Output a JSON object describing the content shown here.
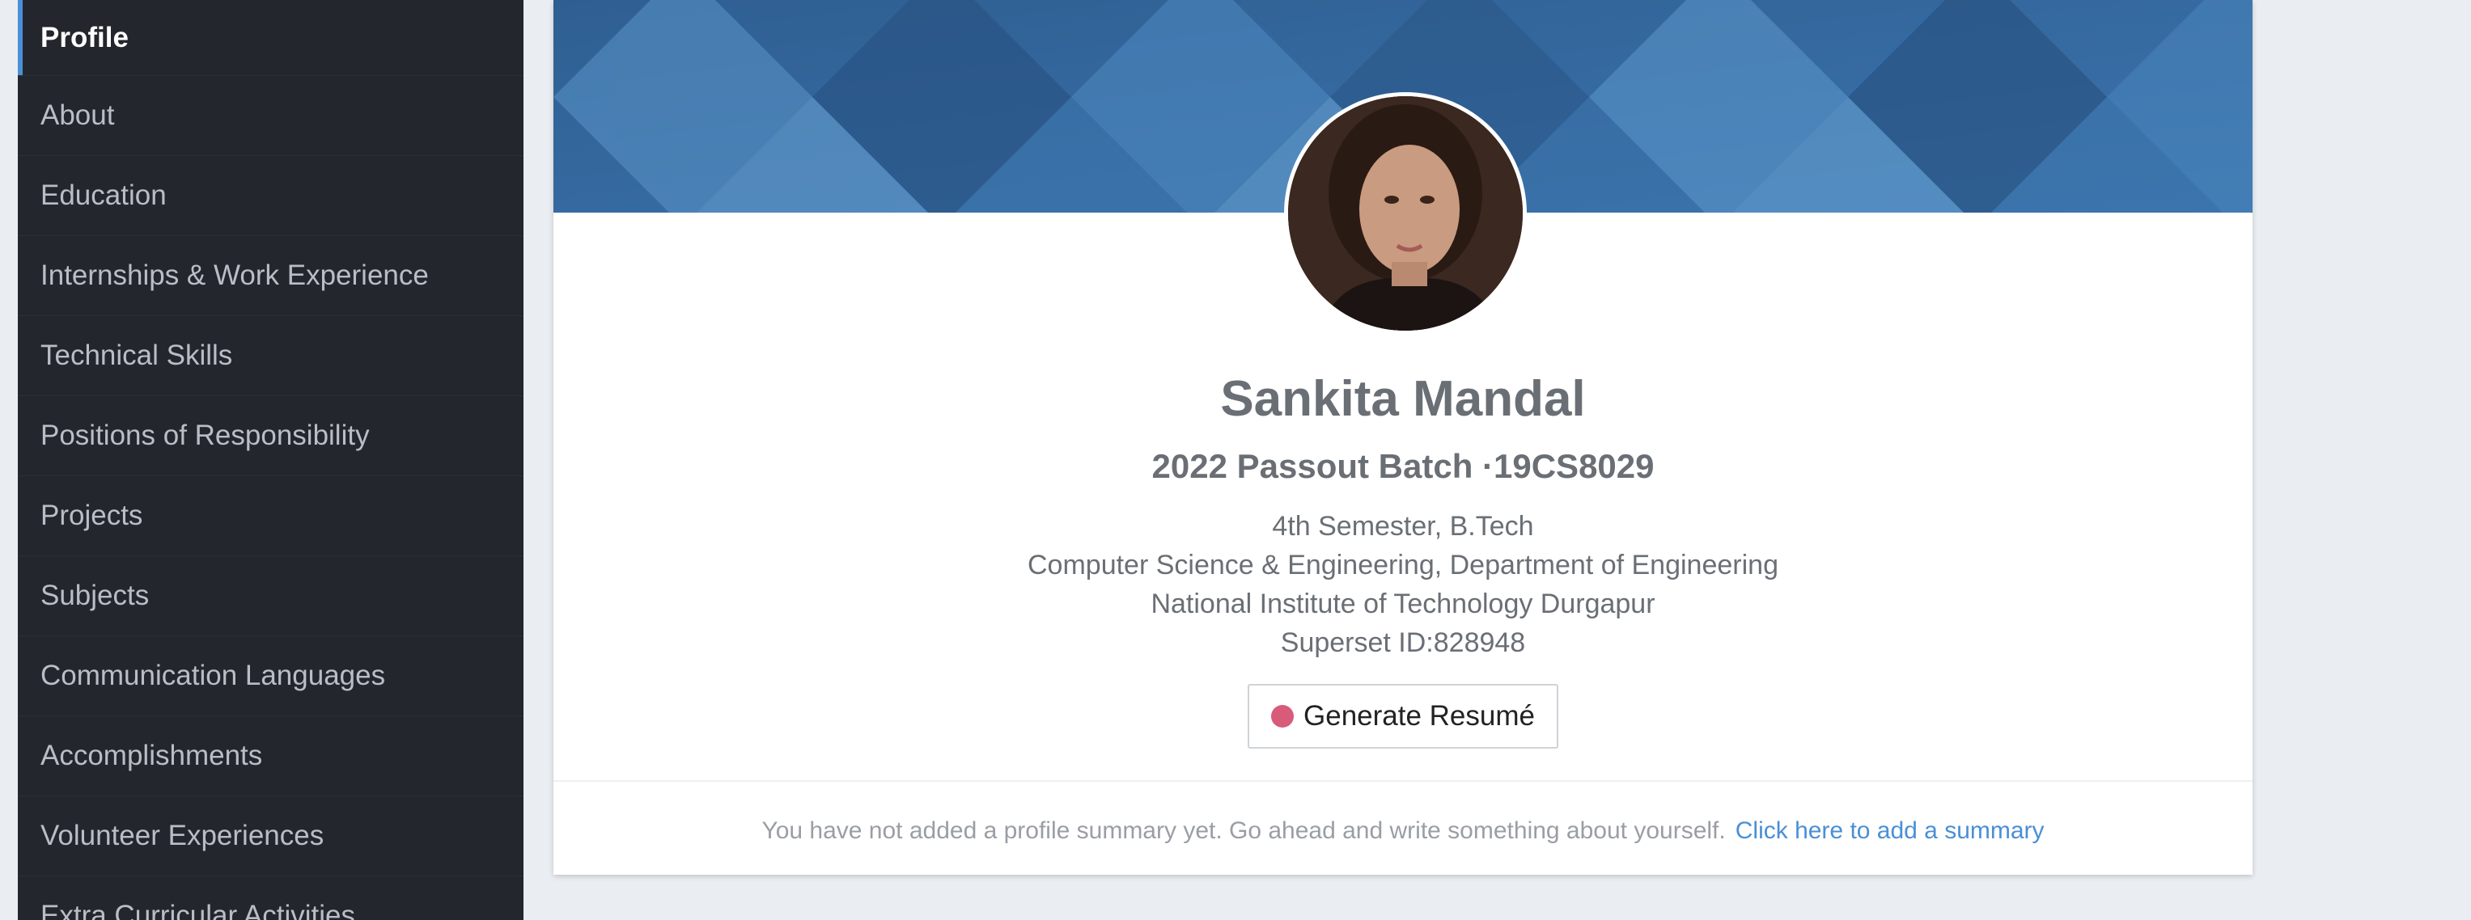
{
  "sidebar": {
    "items": [
      {
        "label": "Profile",
        "active": true
      },
      {
        "label": "About"
      },
      {
        "label": "Education"
      },
      {
        "label": "Internships & Work Experience"
      },
      {
        "label": "Technical Skills"
      },
      {
        "label": "Positions of Responsibility"
      },
      {
        "label": "Projects"
      },
      {
        "label": "Subjects"
      },
      {
        "label": "Communication Languages"
      },
      {
        "label": "Accomplishments"
      },
      {
        "label": "Volunteer Experiences"
      },
      {
        "label": "Extra Curricular Activities"
      }
    ]
  },
  "profile": {
    "name": "Sankita Mandal",
    "batch": "2022 Passout Batch ·19CS8029",
    "semester": "4th Semester, B.Tech",
    "department": "Computer Science & Engineering, Department of Engineering",
    "institute": "National Institute of Technology Durgapur",
    "superset_id": "Superset ID:828948",
    "generate_resume_label": "Generate Resumé"
  },
  "summary": {
    "message": "You have not added a profile summary yet. Go ahead and write something about yourself.",
    "link": "Click here to add a summary"
  },
  "colors": {
    "accent": "#4a8fd6",
    "sidebar_bg": "#23262c",
    "resume_dot": "#d85b7a"
  }
}
